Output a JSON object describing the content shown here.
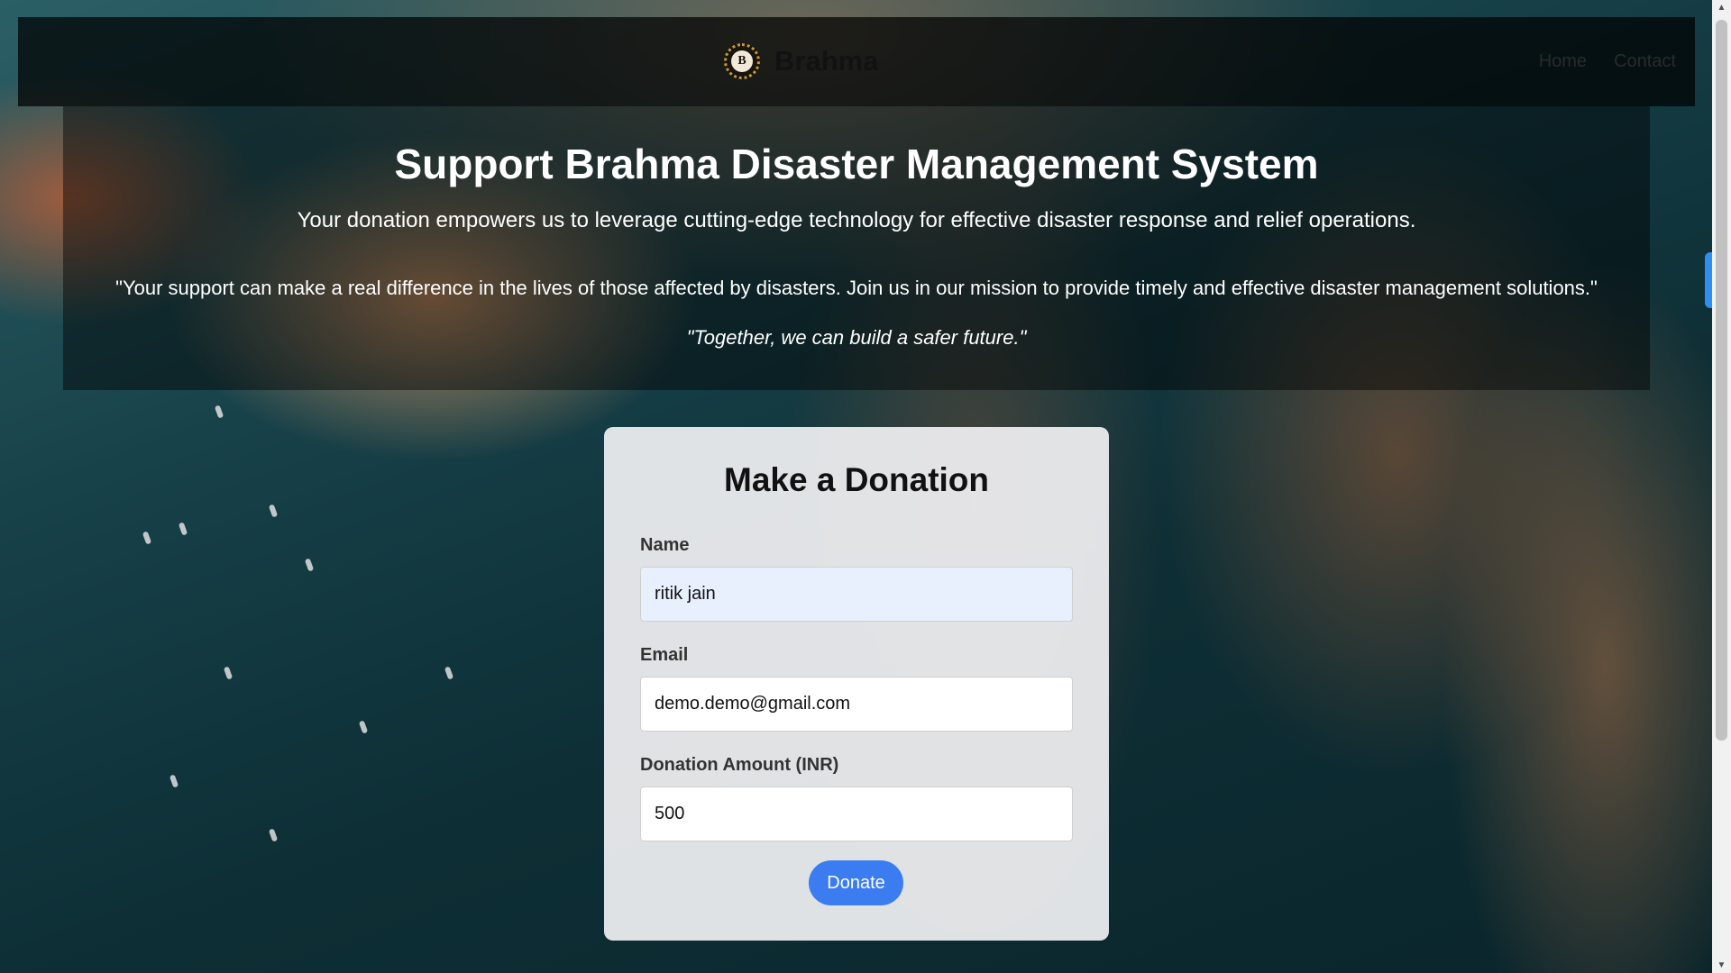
{
  "navbar": {
    "brand_name": "Brahma",
    "logo_letter": "B",
    "links": [
      {
        "label": "Home"
      },
      {
        "label": "Contact"
      }
    ]
  },
  "hero": {
    "title": "Support Brahma Disaster Management System",
    "subtitle": "Your donation empowers us to leverage cutting-edge technology for effective disaster response and relief operations.",
    "quote": "\"Your support can make a real difference in the lives of those affected by disasters. Join us in our mission to provide timely and effective disaster management solutions.\"",
    "tagline": "\"Together, we can build a safer future.\""
  },
  "donation_form": {
    "title": "Make a Donation",
    "name_label": "Name",
    "name_value": "ritik jain",
    "email_label": "Email",
    "email_value": "demo.demo@gmail.com",
    "amount_label": "Donation Amount (INR)",
    "amount_value": "500",
    "submit_label": "Donate"
  },
  "scrollbar": {
    "up_icon": "up-arrow-icon",
    "down_icon": "down-arrow-icon"
  },
  "colors": {
    "button": "#3b7cf0",
    "autofill_bg": "#e8f0fe",
    "side_tab": "#2f8ff0"
  }
}
